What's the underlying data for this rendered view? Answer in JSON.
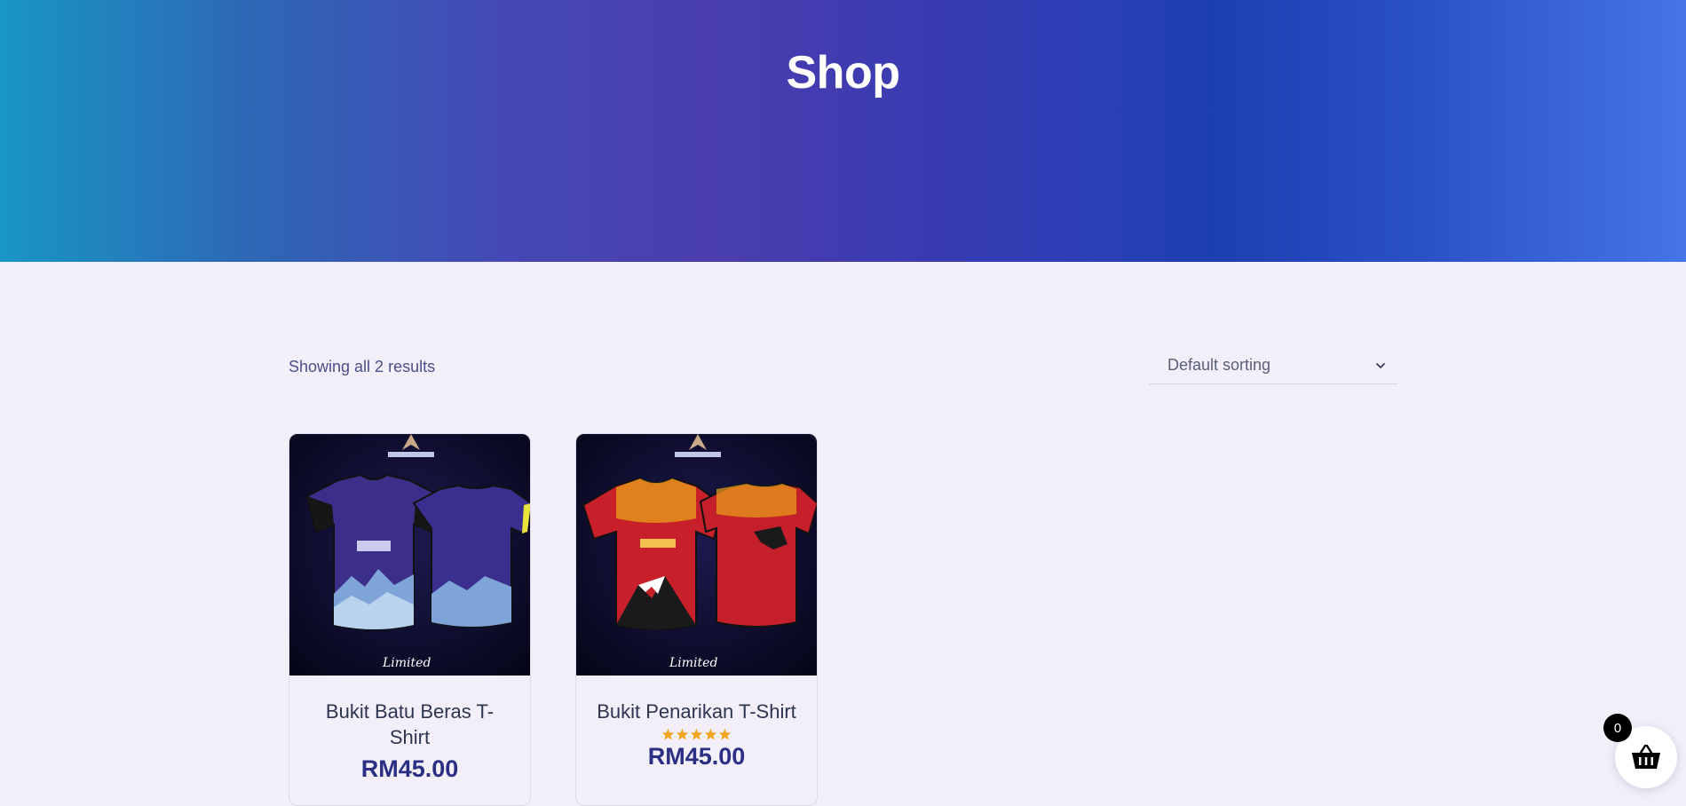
{
  "header": {
    "title": "Shop"
  },
  "toolbar": {
    "result_count": "Showing all 2 results",
    "sort_selected": "Default sorting",
    "sort_icon": "chevron-down-icon"
  },
  "products": [
    {
      "title": "Bukit Batu Beras T-Shirt",
      "price": "RM45.00",
      "rating": null,
      "shirt_color": "#3b2f8a"
    },
    {
      "title": "Bukit Penarikan T-Shirt",
      "price": "RM45.00",
      "rating": 5,
      "shirt_color": "#c8202a"
    }
  ],
  "cart": {
    "count": "0",
    "icon": "basket-icon"
  },
  "colors": {
    "accent": "#2b2f84",
    "star": "#f5a623",
    "page_bg": "#f2eff9"
  }
}
